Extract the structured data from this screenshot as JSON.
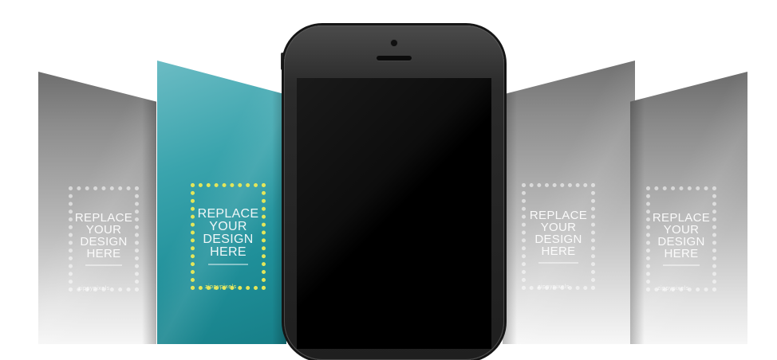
{
  "placeholder": {
    "lines": [
      "REPLACE",
      "YOUR",
      "DESIGN",
      "HERE"
    ],
    "brand": "zippypixels"
  },
  "colors": {
    "teal_screen": "#2a9aa4",
    "placeholder_frame_teal": "#e3e65a",
    "phone_body": "#2a2a2a",
    "phone_screen": "#000000"
  }
}
